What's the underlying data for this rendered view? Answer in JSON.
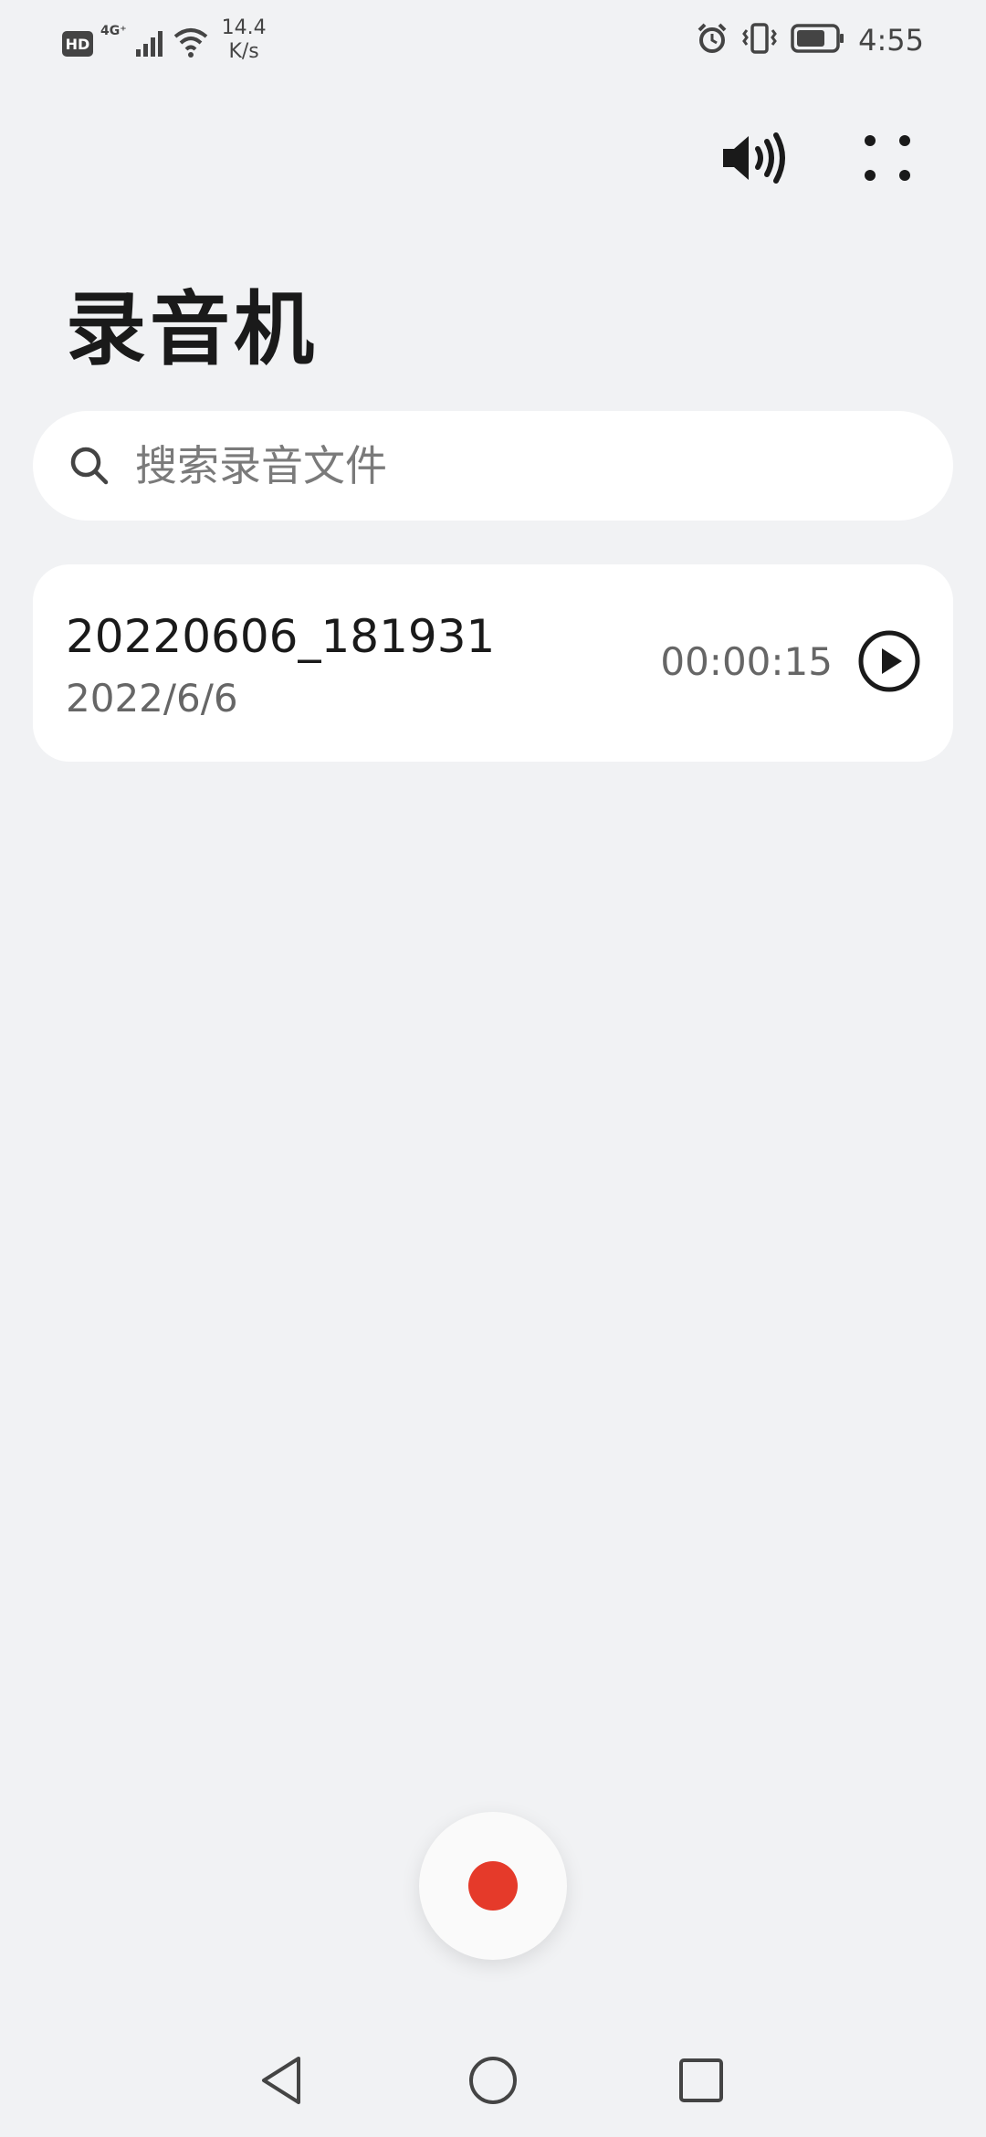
{
  "status_bar": {
    "hd": "HD",
    "network": "4G⁺",
    "speed_value": "14.4",
    "speed_unit": "K/s",
    "time": "4:55"
  },
  "app": {
    "title": "录音机"
  },
  "search": {
    "placeholder": "搜索录音文件"
  },
  "recordings": [
    {
      "name": "20220606_181931",
      "date": "2022/6/6",
      "duration": "00:00:15"
    }
  ],
  "icons": {
    "speaker": "speaker-icon",
    "more": "more-dots-icon",
    "search": "search-icon",
    "play": "play-icon",
    "record": "record-icon",
    "back": "nav-back-icon",
    "home": "nav-home-icon",
    "recent": "nav-recent-icon"
  },
  "colors": {
    "background": "#f1f2f4",
    "card": "#ffffff",
    "record_red": "#e53a2a",
    "text_primary": "#1a1a1a",
    "text_secondary": "#666666"
  }
}
